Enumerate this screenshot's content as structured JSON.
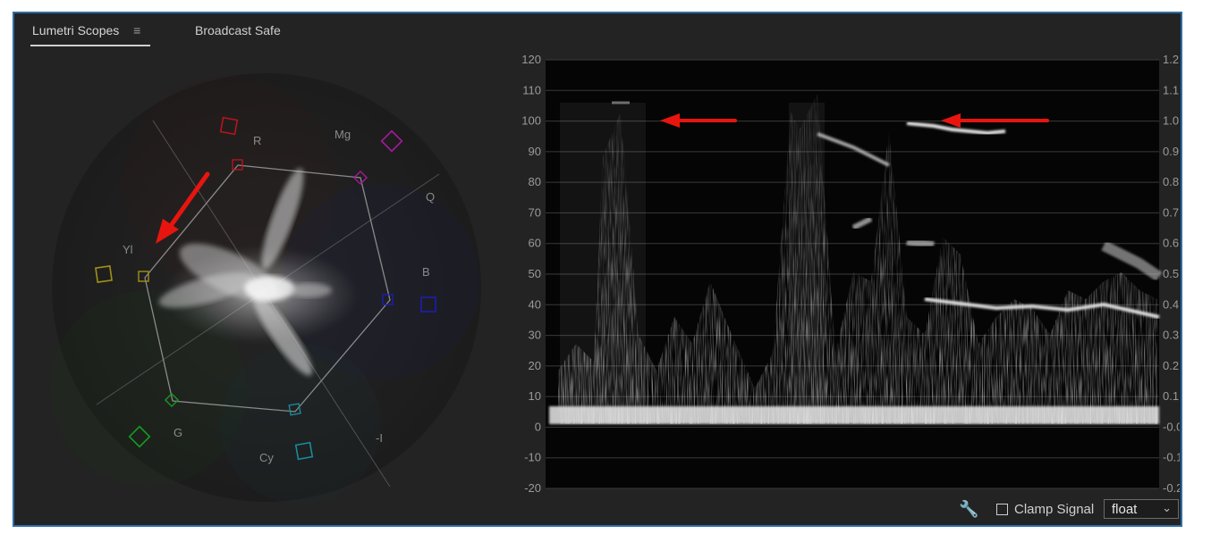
{
  "tabs": {
    "active": "Lumetri Scopes",
    "menu_icon": "≡",
    "second": "Broadcast Safe"
  },
  "vectorscope": {
    "labels": {
      "r": "R",
      "mg": "Mg",
      "q": "Q",
      "b": "B",
      "yl": "Yl",
      "g": "G",
      "cy": "Cy",
      "i": "-I"
    },
    "target_colors": {
      "r": "#b3161c",
      "mg": "#a51a9c",
      "b": "#1b1fb0",
      "cy": "#1a8a99",
      "g": "#169a22",
      "yl": "#a09018"
    }
  },
  "waveform": {
    "left_ticks": [
      "120",
      "110",
      "100",
      "90",
      "80",
      "70",
      "60",
      "50",
      "40",
      "30",
      "20",
      "10",
      "0",
      "-10",
      "-20"
    ],
    "right_ticks": [
      "1.2",
      "1.1",
      "1.0",
      "0.9",
      "0.8",
      "0.7",
      "0.6",
      "0.5",
      "0.4",
      "0.3",
      "0.2",
      "0.1",
      "-0.0",
      "-0.1",
      "-0.2"
    ]
  },
  "annotations": {
    "arrow_color": "#e8150f"
  },
  "bottom_bar": {
    "wrench_icon": "🔧",
    "clamp_label": "Clamp Signal",
    "dropdown_value": "float",
    "dropdown_chevron": "⌄"
  }
}
